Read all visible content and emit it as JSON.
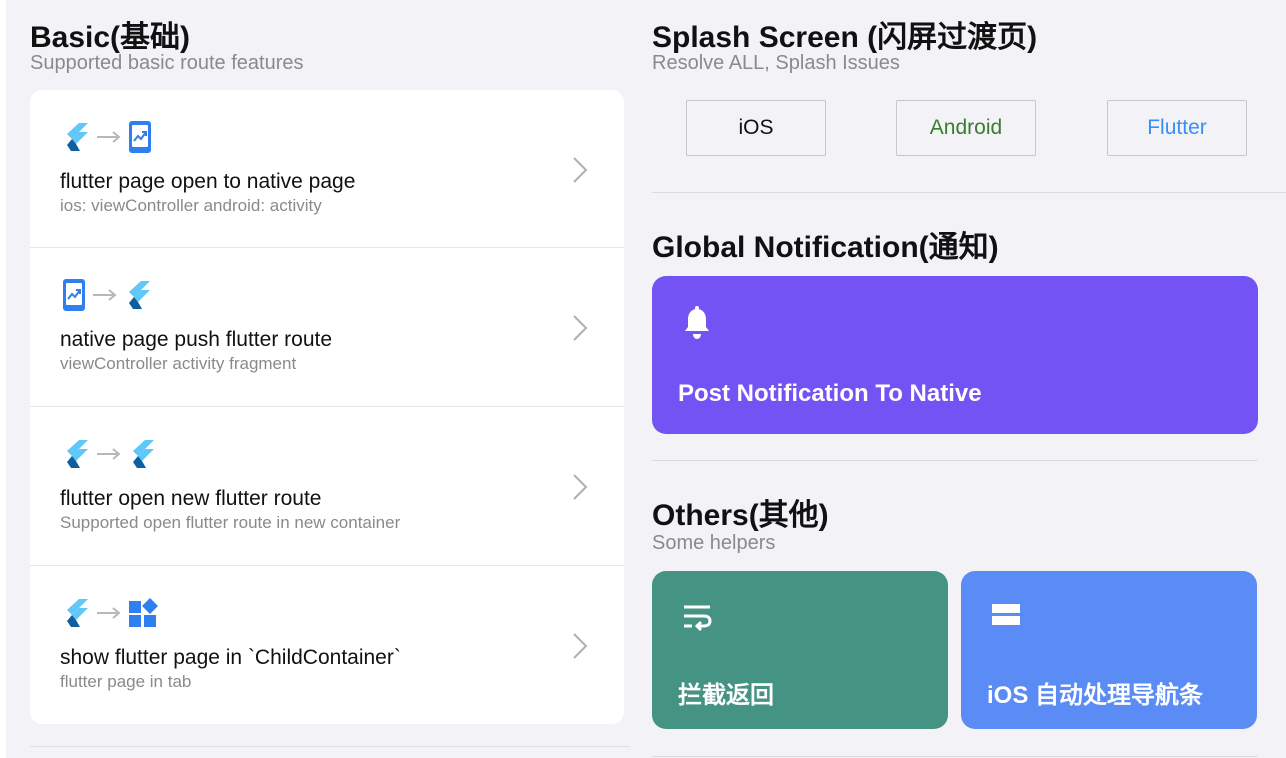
{
  "basic": {
    "title": "Basic(基础)",
    "subtitle": "Supported basic route features",
    "rows": [
      {
        "title": "flutter page open to native page",
        "subtitle": "ios: viewController android: activity"
      },
      {
        "title": "native page push flutter route",
        "subtitle": "viewController activity fragment"
      },
      {
        "title": "flutter open new flutter route",
        "subtitle": "Supported open flutter route in new container"
      },
      {
        "title": "show flutter page in `ChildContainer`",
        "subtitle": "flutter page in tab"
      }
    ]
  },
  "splash": {
    "title": "Splash Screen (闪屏过渡页)",
    "subtitle": "Resolve ALL, Splash Issues",
    "buttons": [
      {
        "label": "iOS",
        "color": "#111111"
      },
      {
        "label": "Android",
        "color": "#3a7d2c"
      },
      {
        "label": "Flutter",
        "color": "#3b8ef5"
      }
    ]
  },
  "notification": {
    "title": "Global Notification(通知)",
    "card_label": "Post Notification To Native",
    "card_color": "#7453f5",
    "icon": "bell-icon"
  },
  "others": {
    "title": "Others(其他)",
    "subtitle": "Some helpers",
    "tiles": [
      {
        "label": "拦截返回",
        "color": "#459483",
        "icon": "wrap-return-icon"
      },
      {
        "label": "iOS 自动处理导航条",
        "color": "#5b8cf5",
        "icon": "navbar-icon"
      }
    ]
  },
  "colors": {
    "background": "#f2f2f7",
    "flutter_light": "#5fc8f8",
    "flutter_dark": "#0d5fa0",
    "native_blue": "#2f7ff0",
    "arrow_gray": "#b8b8bc"
  }
}
